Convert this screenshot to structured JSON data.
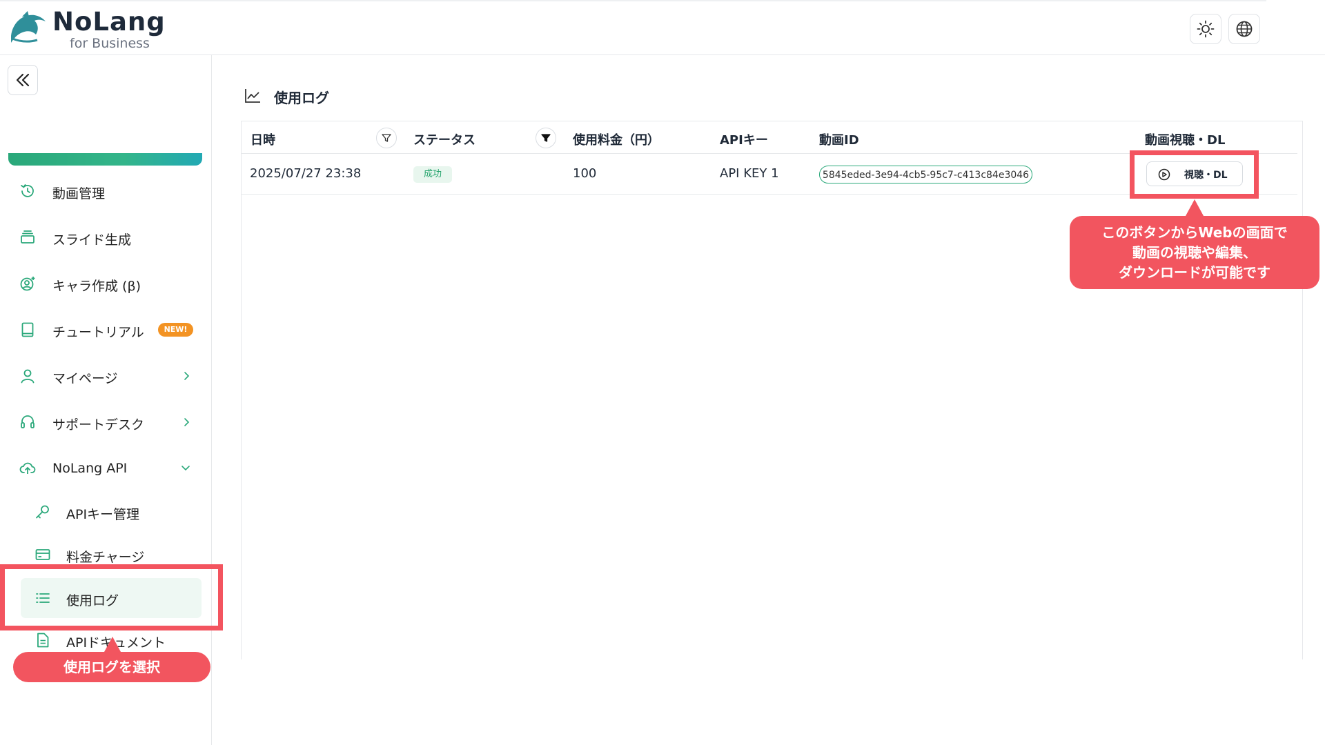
{
  "header": {
    "brand_name": "NoLang",
    "brand_sub": "for Business",
    "theme_icon": "sun-icon",
    "language_icon": "globe-icon"
  },
  "sidebar": {
    "collapse_icon": "double-chevron-left-icon",
    "progress_percent": 100,
    "items": [
      {
        "label": "動画管理",
        "icon": "history-icon"
      },
      {
        "label": "スライド生成",
        "icon": "layers-icon"
      },
      {
        "label": "キャラ作成 (β)",
        "icon": "character-icon"
      },
      {
        "label": "チュートリアル",
        "icon": "book-icon",
        "badge": "NEW!"
      },
      {
        "label": "マイページ",
        "icon": "user-icon"
      },
      {
        "label": "サポートデスク",
        "icon": "headset-icon"
      },
      {
        "label": "NoLang API",
        "icon": "cloud-upload-icon"
      }
    ],
    "sub_items": [
      {
        "label": "APIキー管理",
        "icon": "key-icon"
      },
      {
        "label": "料金チャージ",
        "icon": "credit-card-icon"
      },
      {
        "label": "使用ログ",
        "icon": "list-icon"
      },
      {
        "label": "APIドキュメント",
        "icon": "document-icon"
      }
    ]
  },
  "annotations": {
    "left_callout": "使用ログを選択",
    "right_callout_lines": [
      "このボタンからWebの画面で",
      "動画の視聴や編集、",
      "ダウンロードが可能です"
    ],
    "highlight_color": "#f3545f"
  },
  "main": {
    "title": "使用ログ",
    "title_icon": "line-chart-icon",
    "columns": [
      "日時",
      "ステータス",
      "使用料金（円）",
      "APIキー",
      "動画ID",
      "動画視聴・DL"
    ],
    "rows": [
      {
        "datetime": "2025/07/27 23:38",
        "status": "成功",
        "fee": "100",
        "api_key": "API KEY 1",
        "video_id": "5845eded-3e94-4cb5-95c7-c413c84e3046",
        "action_label": "視聴・DL"
      }
    ]
  },
  "colors": {
    "accent_green": "#2aa87a",
    "badge_orange": "#f39323",
    "callout_red": "#f2555f"
  }
}
